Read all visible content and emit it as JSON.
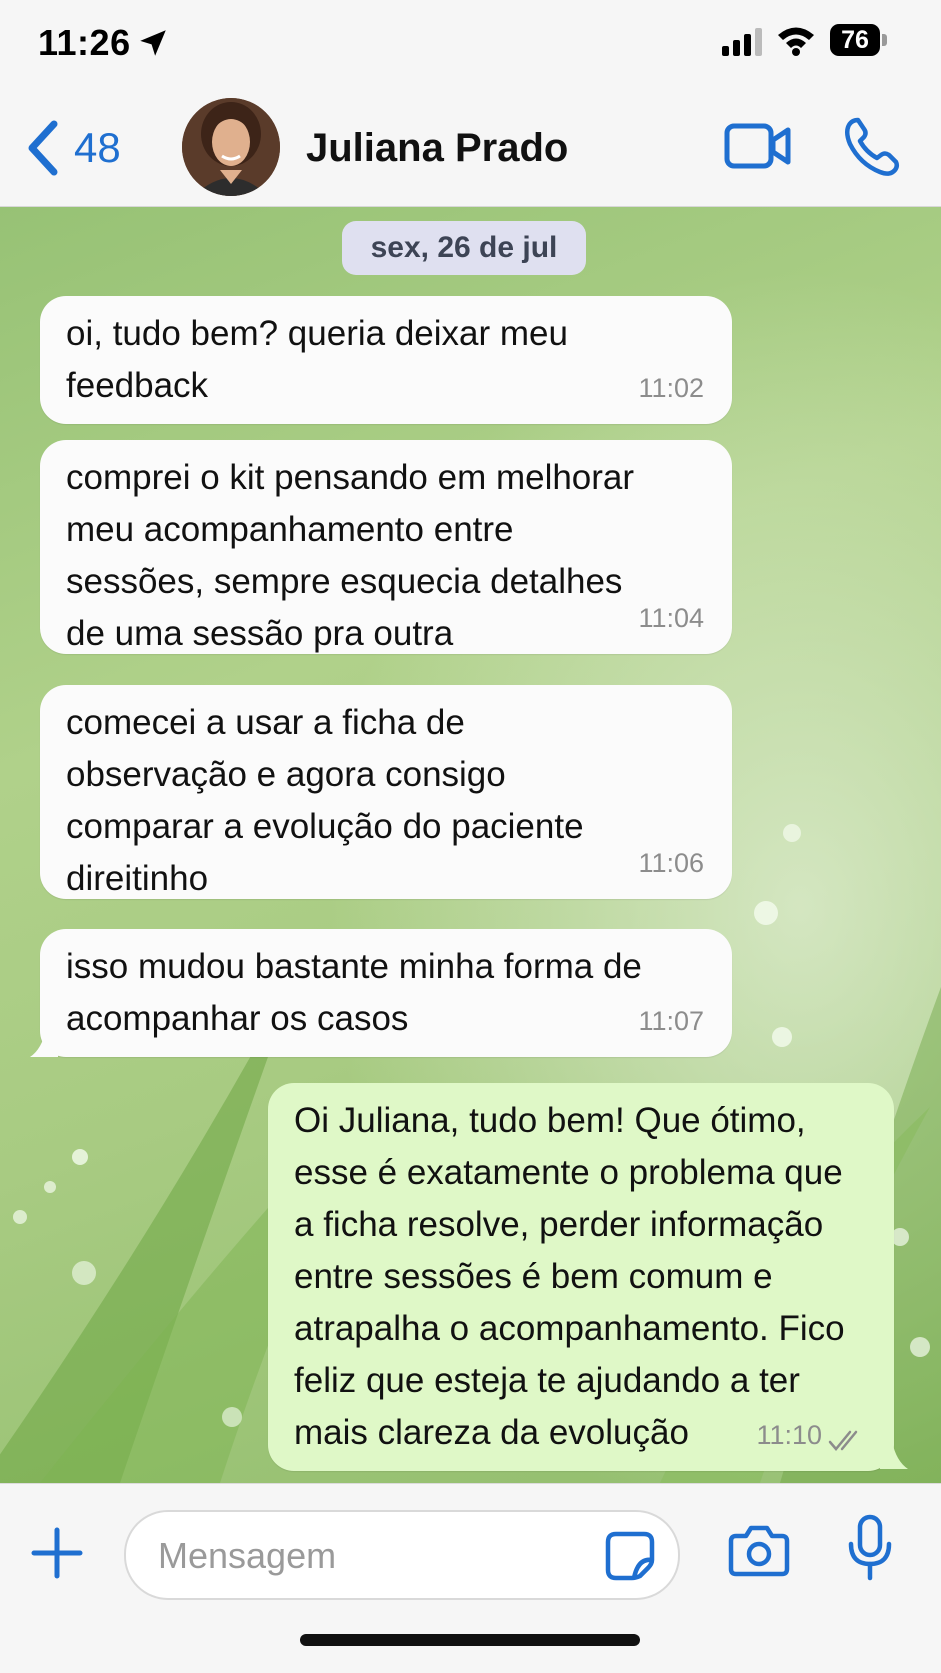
{
  "status_bar": {
    "time": "11:26",
    "battery": "76"
  },
  "header": {
    "back_count": "48",
    "contact_name": "Juliana Prado"
  },
  "chat": {
    "date_label": "sex, 26 de jul",
    "messages": [
      {
        "direction": "incoming",
        "text": "oi, tudo bem? queria deixar meu\nfeedback",
        "time": "11:02"
      },
      {
        "direction": "incoming",
        "text": "comprei o kit pensando em melhorar\nmeu acompanhamento entre\nsessões, sempre esquecia detalhes\nde uma sessão pra outra",
        "time": "11:04"
      },
      {
        "direction": "incoming",
        "text": "comecei a usar a ficha de\nobservação e agora consigo\ncomparar a evolução do paciente\ndireitinho",
        "time": "11:06"
      },
      {
        "direction": "incoming",
        "text": "isso mudou bastante minha forma de\nacompanhar os casos",
        "time": "11:07"
      },
      {
        "direction": "outgoing",
        "text": "Oi Juliana, tudo bem! Que ótimo,\nesse é exatamente o problema que\na ficha resolve, perder informação\nentre sessões é bem comum e\natrapalha o acompanhamento. Fico\nfeliz que esteja te ajudando a ter\nmais clareza da evolução",
        "time": "11:10",
        "status": "read"
      }
    ]
  },
  "composer": {
    "placeholder": "Mensagem"
  },
  "colors": {
    "accent": "#1f6fd0",
    "incoming_bubble": "#fbfbfb",
    "outgoing_bubble": "#dff8c7",
    "date_pill": "#dfe0f0"
  },
  "icons": [
    "location-arrow-icon",
    "signal-icon",
    "wifi-icon",
    "back-chevron-icon",
    "video-call-icon",
    "phone-icon",
    "plus-icon",
    "sticker-icon",
    "camera-icon",
    "microphone-icon",
    "double-check-icon"
  ]
}
